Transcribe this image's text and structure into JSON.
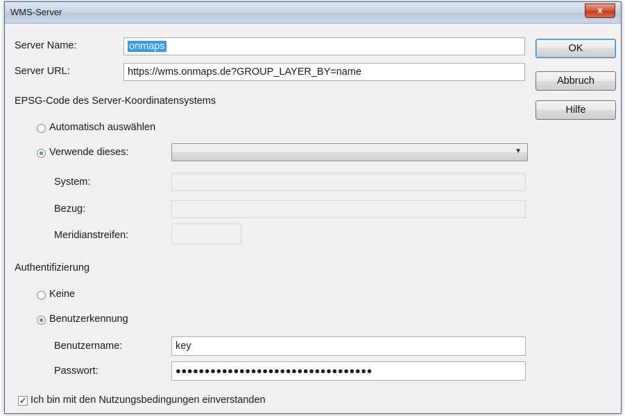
{
  "window": {
    "title": "WMS-Server",
    "close_glyph": "x"
  },
  "server": {
    "name_label": "Server Name:",
    "name_value": "onmaps",
    "url_label": "Server URL:",
    "url_value": "https://wms.onmaps.de?GROUP_LAYER_BY=name"
  },
  "buttons": {
    "ok": "OK",
    "cancel": "Abbruch",
    "help": "Hilfe"
  },
  "epsg": {
    "section_label": "EPSG-Code des Server-Koordinatensystems",
    "auto_label": "Automatisch auswählen",
    "auto_selected": false,
    "use_label": "Verwende dieses:",
    "use_selected": true,
    "combo_value": "",
    "system_label": "System:",
    "system_value": "",
    "bezug_label": "Bezug:",
    "bezug_value": "",
    "meridian_label": "Meridianstreifen:",
    "meridian_value": ""
  },
  "auth": {
    "section_label": "Authentifizierung",
    "none_label": "Keine",
    "none_selected": false,
    "user_label": "Benutzerkennung",
    "user_selected": true,
    "username_label": "Benutzername:",
    "username_value": "key",
    "password_label": "Passwort:",
    "password_value": "●●●●●●●●●●●●●●●●●●●●●●●●●●●●●●●●●●"
  },
  "terms": {
    "label": "Ich bin mit den Nutzungsbedingungen einverstanden",
    "checked": true,
    "check_glyph": "✓"
  },
  "icons": {
    "close": "close-icon",
    "dropdown": "chevron-down-icon"
  }
}
